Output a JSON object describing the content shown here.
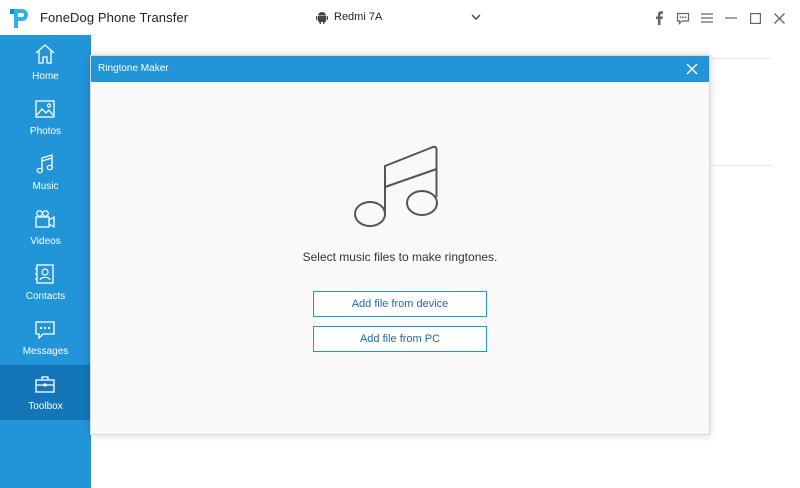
{
  "app": {
    "title": "FoneDog Phone Transfer"
  },
  "device": {
    "name": "Redmi 7A"
  },
  "window_controls": [
    "facebook-icon",
    "feedback-icon",
    "menu-icon",
    "minimize-icon",
    "maximize-icon",
    "close-icon"
  ],
  "sidebar": {
    "items": [
      {
        "label": "Home",
        "icon": "home-icon",
        "active": false
      },
      {
        "label": "Photos",
        "icon": "photos-icon",
        "active": false
      },
      {
        "label": "Music",
        "icon": "music-note-icon",
        "active": false
      },
      {
        "label": "Videos",
        "icon": "video-camera-icon",
        "active": false
      },
      {
        "label": "Contacts",
        "icon": "contacts-icon",
        "active": false
      },
      {
        "label": "Messages",
        "icon": "messages-icon",
        "active": false
      },
      {
        "label": "Toolbox",
        "icon": "toolbox-icon",
        "active": true
      }
    ]
  },
  "dialog": {
    "title": "Ringtone Maker",
    "prompt": "Select music files to make ringtones.",
    "button_device": "Add file from device",
    "button_pc": "Add file from PC"
  },
  "colors": {
    "accent": "#2195d8",
    "sidebar_active": "#1276b7",
    "button_text": "#2168a8"
  }
}
